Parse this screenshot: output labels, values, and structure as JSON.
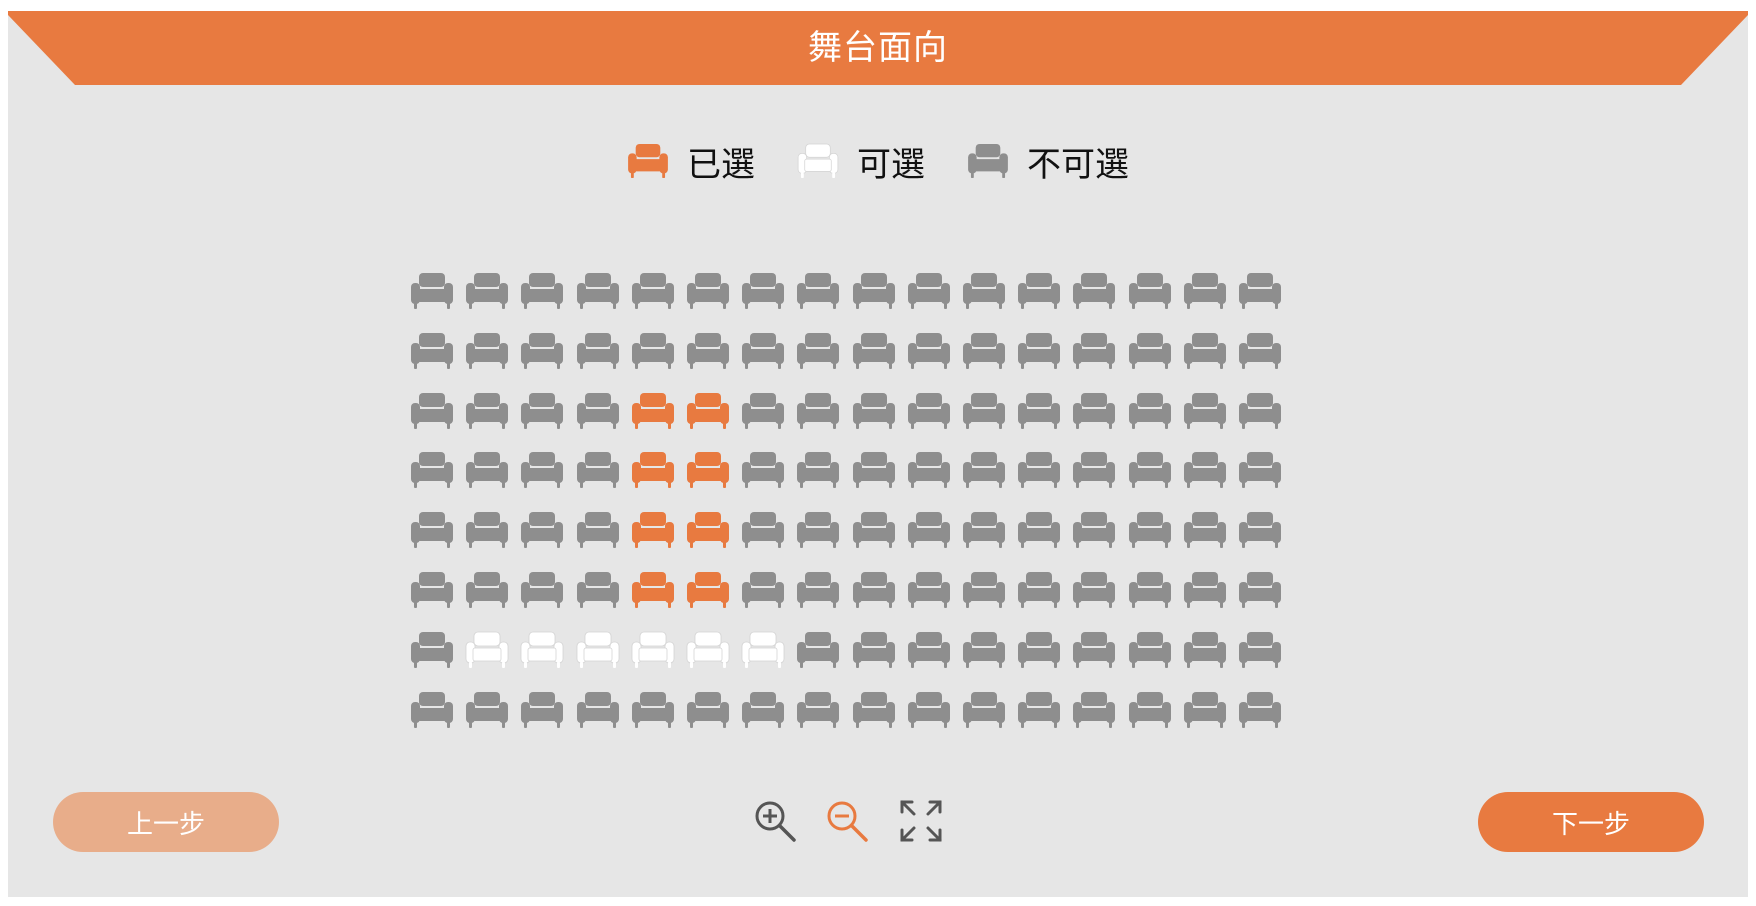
{
  "stage": {
    "title": "舞台面向"
  },
  "legend": {
    "items": [
      {
        "key": "selected",
        "label": "已選",
        "color": "#e87a40"
      },
      {
        "key": "available",
        "label": "可選",
        "color": "#ffffff"
      },
      {
        "key": "unavailable",
        "label": "不可選",
        "color": "#8e8e8e"
      }
    ]
  },
  "seating": {
    "rows": 8,
    "cols": 16,
    "selected": [
      [
        2,
        4
      ],
      [
        2,
        5
      ],
      [
        3,
        4
      ],
      [
        3,
        5
      ],
      [
        4,
        4
      ],
      [
        4,
        5
      ],
      [
        5,
        4
      ],
      [
        5,
        5
      ]
    ],
    "available": [
      [
        6,
        1
      ],
      [
        6,
        2
      ],
      [
        6,
        3
      ],
      [
        6,
        4
      ],
      [
        6,
        5
      ],
      [
        6,
        6
      ]
    ]
  },
  "colors": {
    "accent": "#e87a40",
    "accent_light": "#e8ad8a",
    "panel": "#e6e6e6",
    "unavailable": "#8e8e8e",
    "available": "#ffffff"
  },
  "nav": {
    "prev_label": "上一步",
    "next_label": "下一步"
  },
  "tools": [
    {
      "name": "zoom-in-icon",
      "active": false
    },
    {
      "name": "zoom-out-icon",
      "active": true
    },
    {
      "name": "fullscreen-icon",
      "active": false
    }
  ]
}
